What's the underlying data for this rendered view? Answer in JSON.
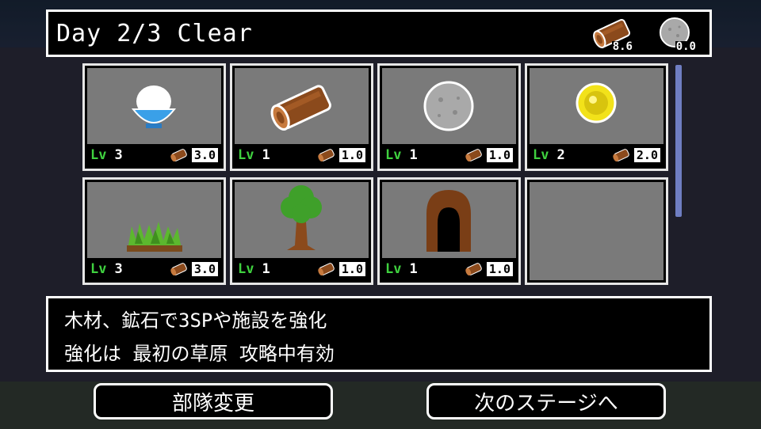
{
  "header": {
    "title": "Day 2/3 Clear",
    "resources": [
      {
        "icon": "wood-log-icon",
        "count": "8.6"
      },
      {
        "icon": "stone-ore-icon",
        "count": "0.0"
      }
    ]
  },
  "cards": [
    {
      "name": "rice-bowl",
      "lv_label": "Lv",
      "level": "3",
      "cost": "3.0"
    },
    {
      "name": "wood-log",
      "lv_label": "Lv",
      "level": "1",
      "cost": "1.0"
    },
    {
      "name": "stone-ore",
      "lv_label": "Lv",
      "level": "1",
      "cost": "1.0"
    },
    {
      "name": "gold-coin",
      "lv_label": "Lv",
      "level": "2",
      "cost": "2.0"
    },
    {
      "name": "grass-field",
      "lv_label": "Lv",
      "level": "3",
      "cost": "3.0"
    },
    {
      "name": "tree",
      "lv_label": "Lv",
      "level": "1",
      "cost": "1.0"
    },
    {
      "name": "cave",
      "lv_label": "Lv",
      "level": "1",
      "cost": "1.0"
    }
  ],
  "description": {
    "line1": "木材、鉱石で3SPや施設を強化",
    "line2": "強化は 最初の草原 攻略中有効"
  },
  "buttons": {
    "formation": "部隊変更",
    "next_stage": "次のステージへ"
  },
  "colors": {
    "level_label": "#3fd13f",
    "card_bg": "#7a7a7a",
    "scrollbar": "#6f7ec2"
  }
}
